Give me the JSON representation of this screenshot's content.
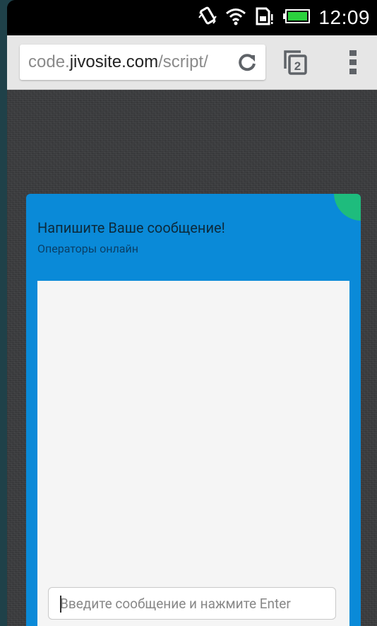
{
  "status_bar": {
    "time": "12:09",
    "icons": [
      "vibrate-icon",
      "wifi-icon",
      "sim-icon",
      "battery-icon"
    ]
  },
  "browser": {
    "url_scheme_part": "code.",
    "url_host": "jivosite.com",
    "url_path": "/script/",
    "tab_count": "2"
  },
  "chat_widget": {
    "title": "Напишите Ваше сообщение!",
    "subtitle": "Операторы онлайн",
    "input_placeholder": "Введите сообщение и нажмите Enter",
    "input_value": "",
    "accent_color": "#0a8ad8",
    "online_indicator_color": "#1ebc7d"
  }
}
